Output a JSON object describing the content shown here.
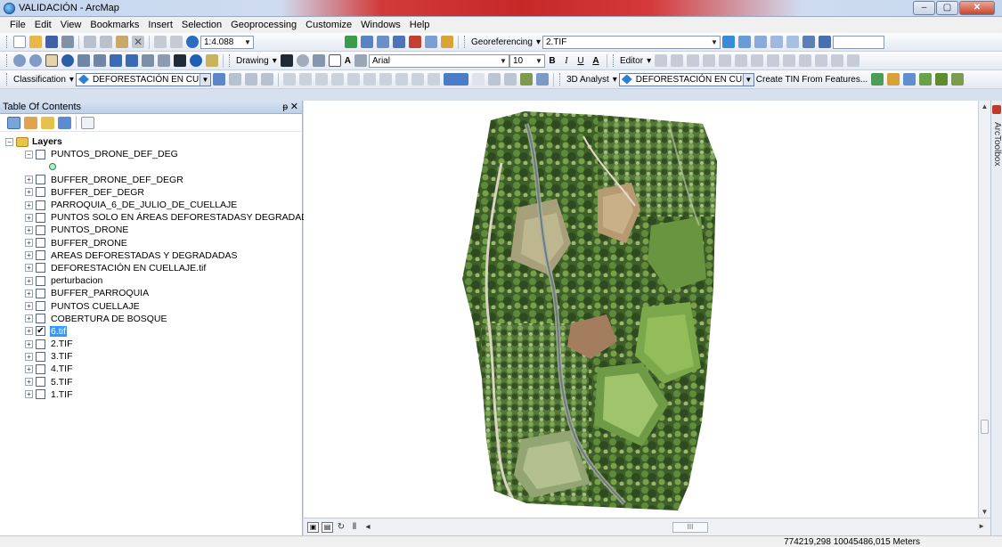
{
  "window": {
    "title": "VALIDACIÓN - ArcMap",
    "controls": [
      "–",
      "▢",
      "✕"
    ]
  },
  "menu": [
    "File",
    "Edit",
    "View",
    "Bookmarks",
    "Insert",
    "Selection",
    "Geoprocessing",
    "Customize",
    "Windows",
    "Help"
  ],
  "toolbar": {
    "scale": "1:4.088",
    "georeferencing_label": "Georeferencing",
    "georeferencing_layer": "2.TIF",
    "drawing_label": "Drawing",
    "font_name": "Arial",
    "font_size": "10",
    "bold": "B",
    "italic": "I",
    "underline": "U",
    "font_color": "A",
    "editor_label": "Editor",
    "classification_label": "Classification",
    "layer_combo": "DEFORESTACIÓN EN CUEL",
    "analyst_label": "3D Analyst",
    "analyst_layer": "DEFORESTACIÓN EN CUEL",
    "create_tin": "Create TIN From Features..."
  },
  "toc": {
    "title": "Table Of Contents",
    "pin": "₽",
    "close": "✕",
    "root": "Layers",
    "layers": [
      {
        "name": "PUNTOS_DRONE_DEF_DEG",
        "checked": false,
        "expanded": true
      },
      {
        "name": "BUFFER_DRONE_DEF_DEGR",
        "checked": false
      },
      {
        "name": "BUFFER_DEF_DEGR",
        "checked": false
      },
      {
        "name": "PARROQUIA_6_DE_JULIO_DE_CUELLAJE",
        "checked": false
      },
      {
        "name": "PUNTOS SOLO EN ÁREAS DEFORESTADASY DEGRADADAS",
        "checked": false
      },
      {
        "name": "PUNTOS_DRONE",
        "checked": false
      },
      {
        "name": "BUFFER_DRONE",
        "checked": false
      },
      {
        "name": "AREAS DEFORESTADAS Y DEGRADADAS",
        "checked": false
      },
      {
        "name": "DEFORESTACIÓN EN CUELLAJE.tif",
        "checked": false
      },
      {
        "name": "perturbacion",
        "checked": false
      },
      {
        "name": "BUFFER_PARROQUIA",
        "checked": false
      },
      {
        "name": "PUNTOS CUELLAJE",
        "checked": false
      },
      {
        "name": "COBERTURA DE BOSQUE",
        "checked": false
      },
      {
        "name": "6.tif",
        "checked": true,
        "selected": true
      },
      {
        "name": "2.TIF",
        "checked": false
      },
      {
        "name": "3.TIF",
        "checked": false
      },
      {
        "name": "4.TIF",
        "checked": false
      },
      {
        "name": "5.TIF",
        "checked": false
      },
      {
        "name": "1.TIF",
        "checked": false
      }
    ],
    "checked_mark": "✔",
    "expand_minus": "−",
    "expand_plus": "+"
  },
  "arctoolbox": {
    "label": "ArcToolbox"
  },
  "mapbar": {
    "scroll_mid": "III",
    "scroll_right": "►"
  },
  "status": {
    "coordinates": "774219,298  10045486,015 Meters"
  }
}
